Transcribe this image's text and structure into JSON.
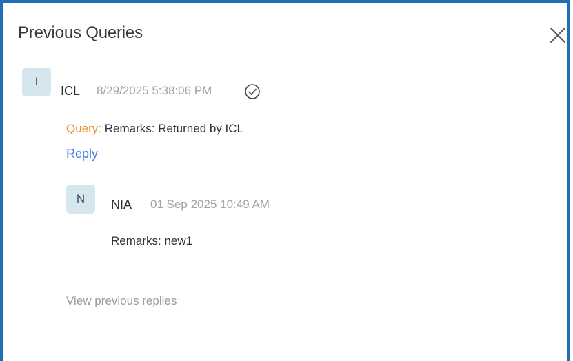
{
  "dialog": {
    "title": "Previous Queries",
    "close_icon": "close-icon"
  },
  "query": {
    "avatar_initial": "I",
    "author": "ICL",
    "timestamp": "8/29/2025 5:38:06 PM",
    "status_icon": "check-circle-icon",
    "label": "Query:",
    "text": " Remarks: Returned by ICL",
    "reply_label": "Reply"
  },
  "reply": {
    "avatar_initial": "N",
    "author": "NIA",
    "timestamp": "01 Sep 2025 10:49 AM",
    "text": "Remarks: new1"
  },
  "view_previous_label": "View previous replies",
  "colors": {
    "border": "#1f6fb6",
    "avatar_bg": "#d6e6ee",
    "query_label": "#e8942a",
    "link": "#3e7fe0"
  }
}
